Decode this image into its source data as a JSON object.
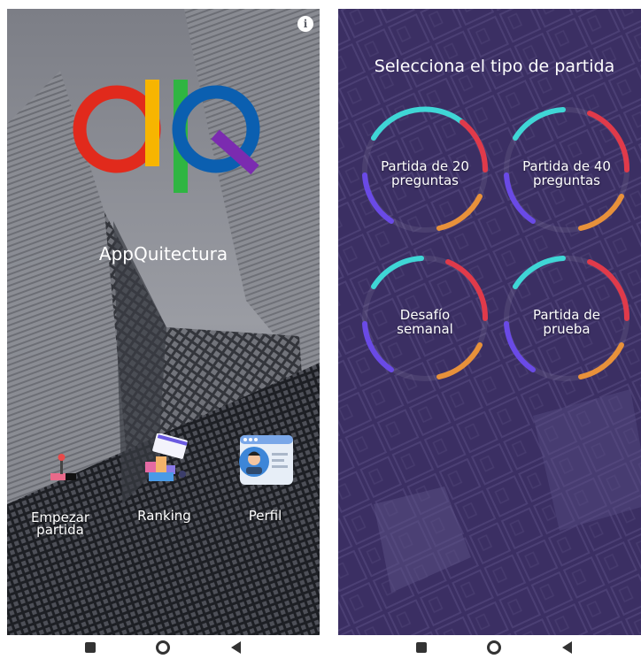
{
  "left_screen": {
    "app_name": "AppQuitectura",
    "menu": [
      {
        "label": "Empezar partida",
        "icon": "joystick-icon"
      },
      {
        "label": "Ranking",
        "icon": "ranking-icon"
      },
      {
        "label": "Perfil",
        "icon": "profile-icon"
      }
    ],
    "info_icon": "info-icon"
  },
  "right_screen": {
    "title": "Selecciona el tipo de partida",
    "options": [
      {
        "label": "Partida de 20 preguntas"
      },
      {
        "label": "Partida de 40 preguntas"
      },
      {
        "label": "Desafío semanal"
      },
      {
        "label": "Partida de prueba"
      }
    ]
  },
  "nav_bar": {
    "buttons": [
      "recents-icon",
      "home-icon",
      "back-icon"
    ]
  },
  "colors": {
    "logo_red": "#e12a1c",
    "logo_yellow": "#f7b500",
    "logo_green": "#2fb542",
    "logo_blue": "#0b5fb0",
    "logo_purple": "#7b2bb0",
    "ring_teal": "#3fd6d6",
    "ring_red": "#e03a4a",
    "ring_orange": "#e8913a",
    "ring_purple": "#6a4ae6",
    "right_bg": "#3b2f62"
  }
}
